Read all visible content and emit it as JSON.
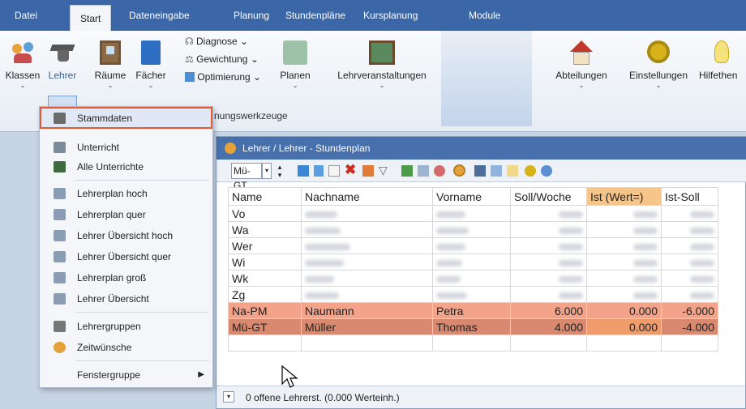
{
  "tabs": [
    "Datei",
    "Start",
    "Dateneingabe",
    "Planung",
    "Stundenpläne",
    "Kursplanung",
    "Module"
  ],
  "ribbon": {
    "klassen": "Klassen",
    "lehrer": "Lehrer",
    "raeume": "Räume",
    "faecher": "Fächer",
    "diagnose": "Diagnose",
    "gewichtung": "Gewichtung",
    "optimierung": "Optimierung",
    "planen": "Planen",
    "planungswerkzeuge": "nungswerkzeuge",
    "lehrveranstaltungen": "Lehrveranstaltungen",
    "abteilungen": "Abteilungen",
    "einstellungen": "Einstellungen",
    "hilfethemen": "Hilfethen"
  },
  "menu": {
    "items": [
      "Stammdaten",
      "Unterricht",
      "Alle Unterrichte",
      "Lehrerplan hoch",
      "Lehrerplan quer",
      "Lehrer Übersicht hoch",
      "Lehrer Übersicht quer",
      "Lehrerplan groß",
      "Lehrer Übersicht",
      "Lehrergruppen",
      "Zeitwünsche",
      "Fenstergruppe"
    ]
  },
  "window": {
    "title": "Lehrer / Lehrer - Stundenplan",
    "selector": "Mü-GT",
    "status": "0 offene Lehrerst. (0.000 Werteinh.)"
  },
  "table": {
    "headers": [
      "Name",
      "Nachname",
      "Vorname",
      "Soll/Woche",
      "Ist (Wert=)",
      "Ist-Soll"
    ],
    "rows": [
      {
        "name": "Vo"
      },
      {
        "name": "Wa"
      },
      {
        "name": "Wer"
      },
      {
        "name": "Wi"
      },
      {
        "name": "Wk"
      },
      {
        "name": "Zg"
      },
      {
        "name": "Na-PM",
        "nachname": "Naumann",
        "vorname": "Petra",
        "soll": "6.000",
        "ist": "0.000",
        "diff": "-6.000"
      },
      {
        "name": "Mü-GT",
        "nachname": "Müller",
        "vorname": "Thomas",
        "soll": "4.000",
        "ist": "0.000",
        "diff": "-4.000"
      }
    ]
  },
  "colors": {
    "accent": "#e7582f",
    "tabbar": "#3b66a8",
    "title": "#4770ac"
  }
}
